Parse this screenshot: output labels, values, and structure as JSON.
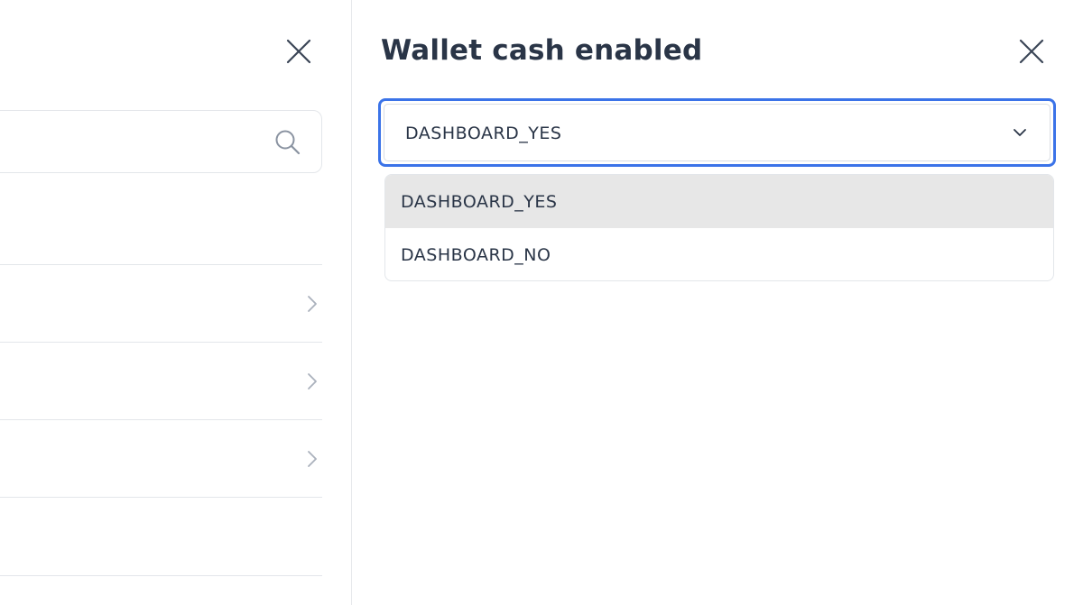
{
  "left_panel": {
    "search": {
      "placeholder": "",
      "value": ""
    },
    "row_count": 4
  },
  "right_panel": {
    "title": "Wallet cash enabled",
    "select": {
      "value": "DASHBOARD_YES",
      "options": [
        {
          "label": "DASHBOARD_YES",
          "selected": true
        },
        {
          "label": "DASHBOARD_NO",
          "selected": false
        }
      ]
    }
  },
  "icons": {
    "close": "close-icon",
    "search": "search-icon",
    "chevron_right": "chevron-right-icon",
    "chevron_down": "chevron-down-icon"
  },
  "colors": {
    "focus_border": "#3b73e8",
    "selected_option_bg": "#e7e7e7",
    "text": "#2a3547",
    "divider": "#e3e6ea"
  }
}
